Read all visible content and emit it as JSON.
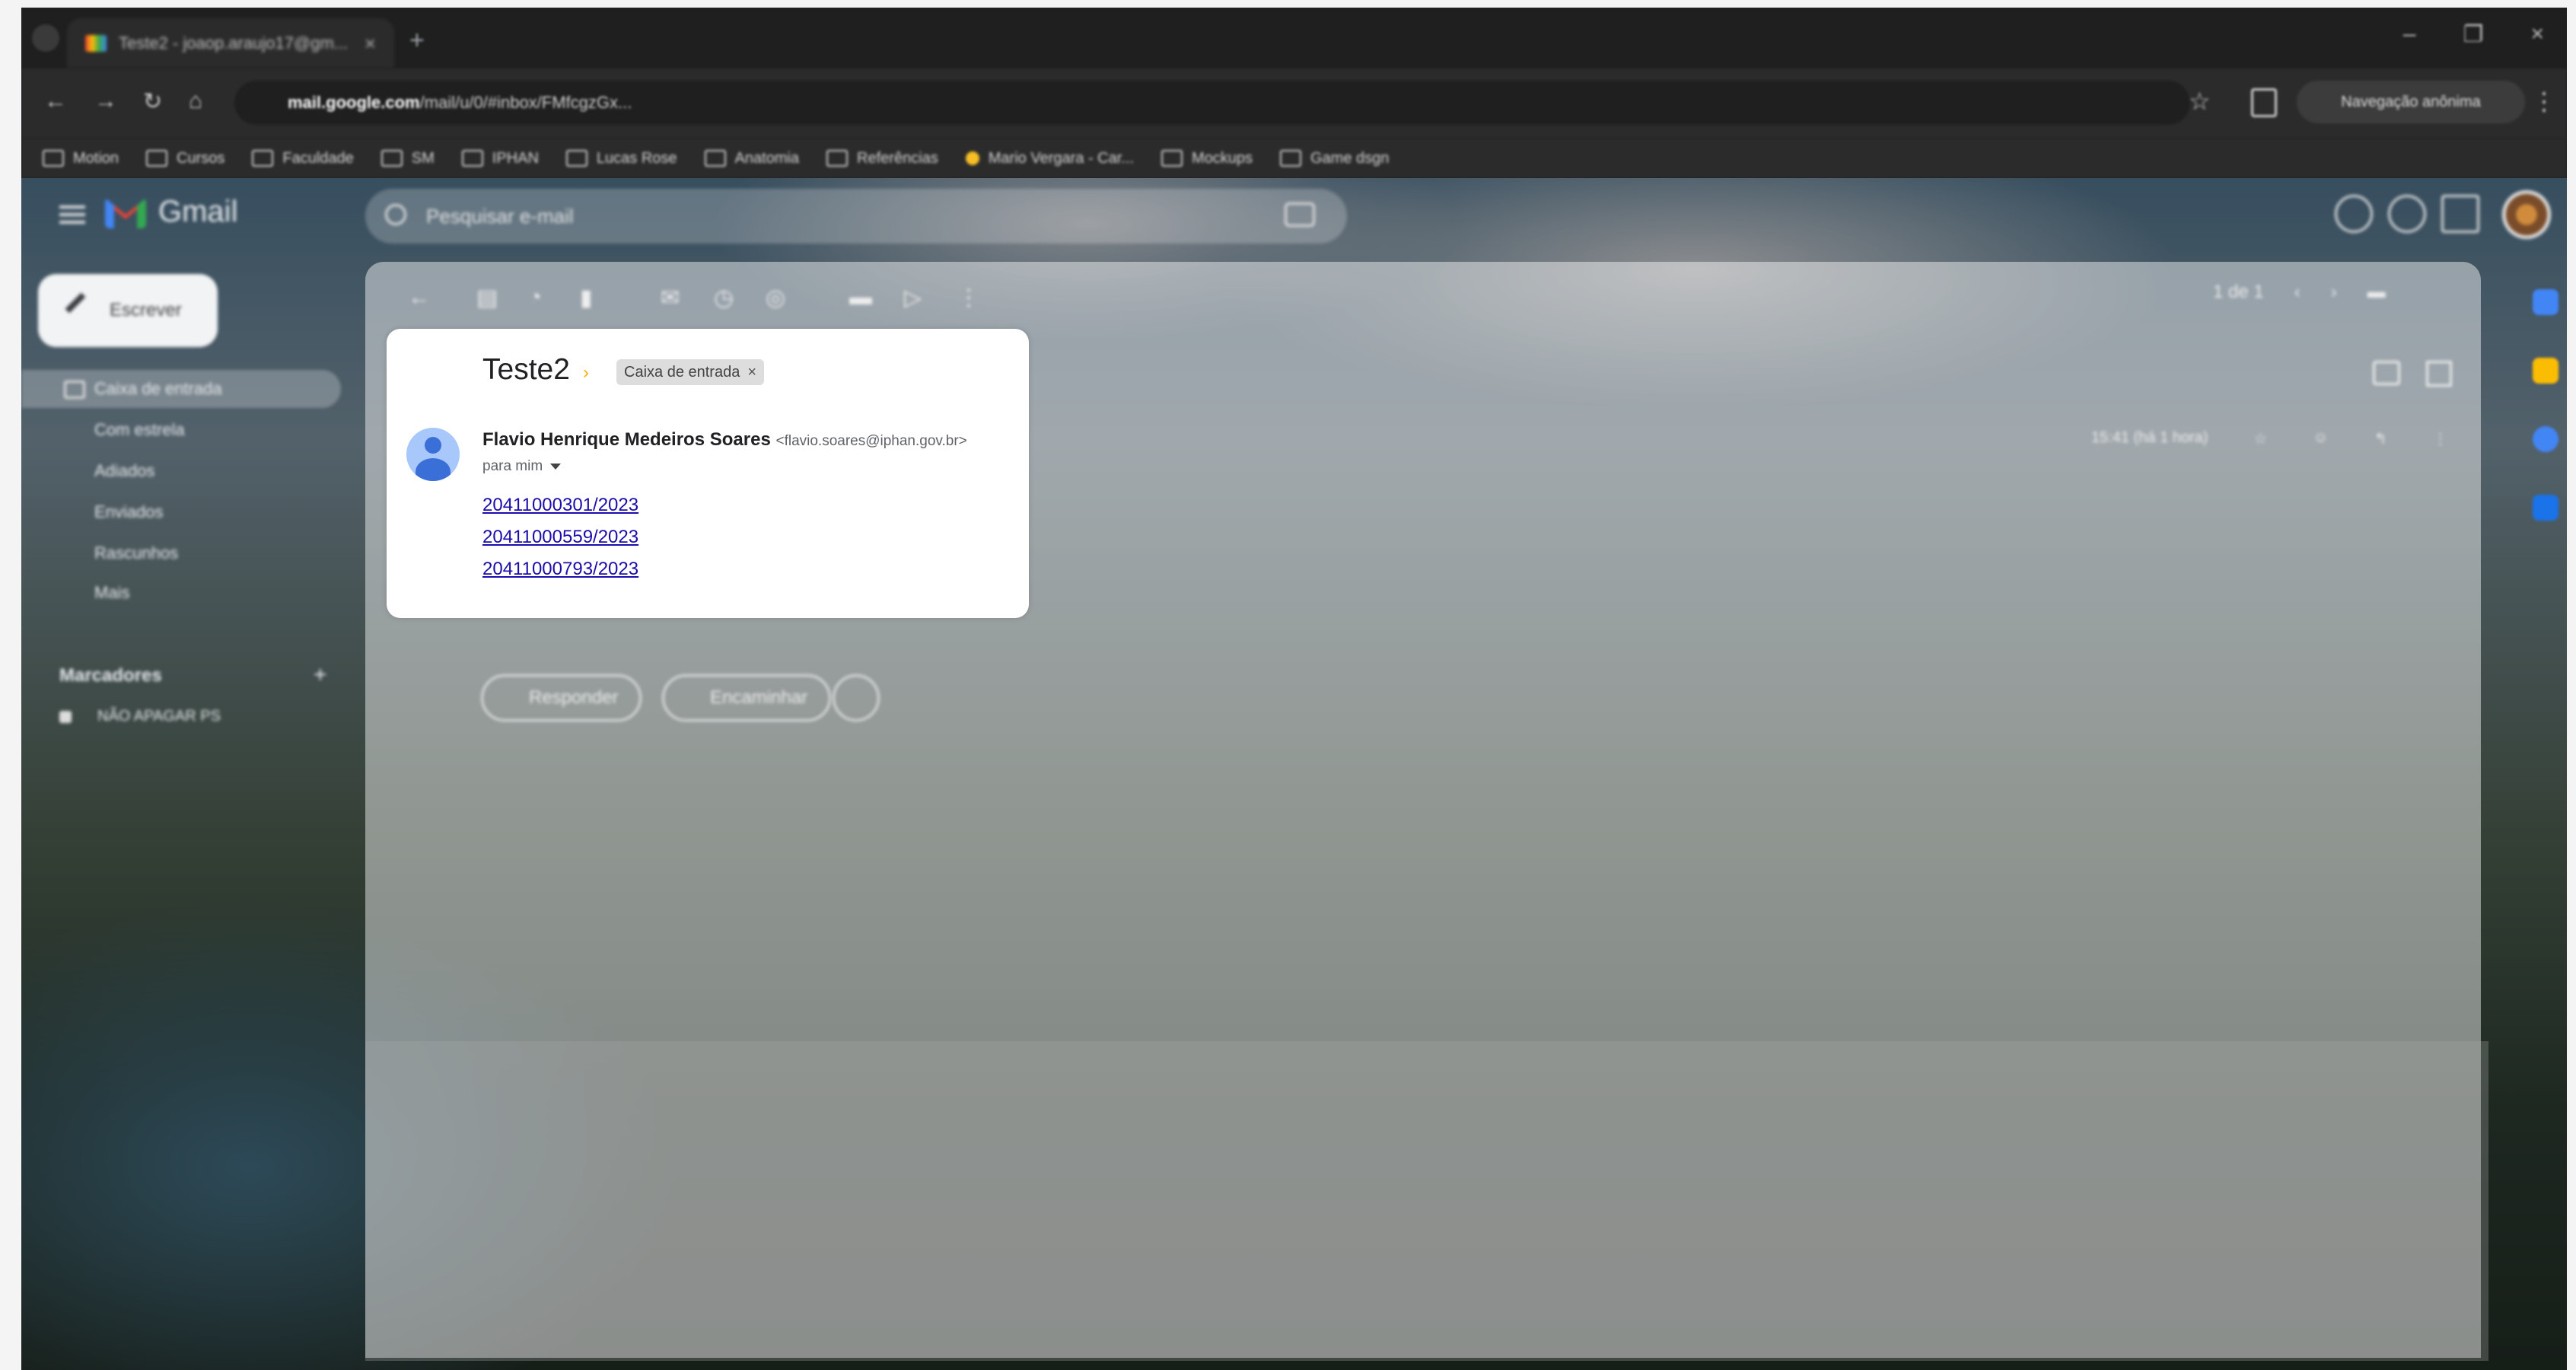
{
  "browser": {
    "tab_title": "Teste2 - joaop.araujo17@gm...",
    "address_host": "mail.google.com",
    "address_path": "/mail/u/0/#inbox/FMfcgzGx...",
    "profile_button": "Navegação anônima",
    "bookmarks": [
      "Motion",
      "Cursos",
      "Faculdade",
      "SM",
      "IPHAN",
      "Lucas Rose",
      "Anatomia",
      "Referências",
      "Mario Vergara - Car...",
      "Mockups",
      "Game dsgn"
    ]
  },
  "gmail": {
    "app_name": "Gmail",
    "search_placeholder": "Pesquisar e-mail",
    "compose_label": "Escrever",
    "nav": [
      {
        "label": "Caixa de entrada"
      },
      {
        "label": "Com estrela"
      },
      {
        "label": "Adiados"
      },
      {
        "label": "Enviados"
      },
      {
        "label": "Rascunhos"
      },
      {
        "label": "Mais"
      }
    ],
    "labels_header": "Marcadores",
    "labels": [
      "NÃO APAGAR PS"
    ],
    "pager_text": "1 de 1",
    "message_time": "15:41 (há 1 hora)",
    "reply_label": "Responder",
    "forward_label": "Encaminhar"
  },
  "email": {
    "subject": "Teste2",
    "label_chip": "Caixa de entrada",
    "sender_name": "Flavio Henrique Medeiros Soares",
    "sender_email": "<flavio.soares@iphan.gov.br>",
    "recipient": "para mim",
    "links": [
      "20411000301/2023",
      "20411000559/2023",
      "20411000793/2023"
    ]
  },
  "colors": {
    "card_bg": "#ffffff",
    "link": "#1a0dab",
    "importance": "#f4b400",
    "avatar_bg": "#a8c7fa"
  }
}
